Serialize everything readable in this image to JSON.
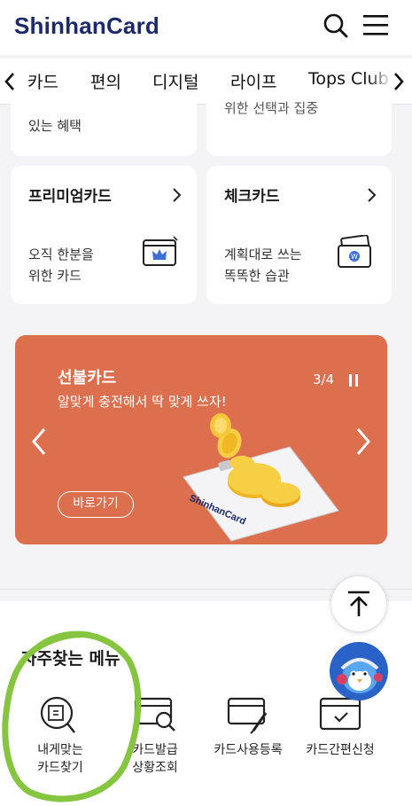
{
  "header": {
    "logo": "ShinhanCard",
    "icons": {
      "search": "search-icon",
      "menu": "hamburger-menu-icon"
    }
  },
  "tabs": [
    {
      "label": "카드",
      "active": true
    },
    {
      "label": "편의",
      "active": false
    },
    {
      "label": "디지털",
      "active": false
    },
    {
      "label": "라이프",
      "active": false
    },
    {
      "label": "Tops Club",
      "active": false
    }
  ],
  "tiles": {
    "top_left_partial": "있는 혜택",
    "top_right_partial": "위한 선택과 집중",
    "premium": {
      "title": "프리미엄카드",
      "desc": "오직 한분을\n위한 카드",
      "icon": "premium-card-crown-icon"
    },
    "check": {
      "title": "체크카드",
      "desc": "계획대로 쓰는\n똑똑한 습관",
      "icon": "check-card-won-icon"
    }
  },
  "banner": {
    "title": "선불카드",
    "subtitle": "알맞게 충전해서 딱 맞게 쓰자!",
    "page": "3/4",
    "button": "바로가기",
    "card_brand": "ShinhanCard",
    "color": "#dc6f4d"
  },
  "favorites": {
    "title": "자주찾는 메뉴",
    "items": [
      {
        "label": "내게맞는\n카드찾기",
        "icon": "card-search-icon"
      },
      {
        "label": "카드발급\n상황조회",
        "icon": "issue-status-icon"
      },
      {
        "label": "카드사용등록",
        "icon": "card-register-icon"
      },
      {
        "label": "카드간편신청",
        "icon": "easy-apply-icon"
      }
    ]
  },
  "colors": {
    "brand": "#1c2a6b",
    "annotation": "#86c540"
  }
}
